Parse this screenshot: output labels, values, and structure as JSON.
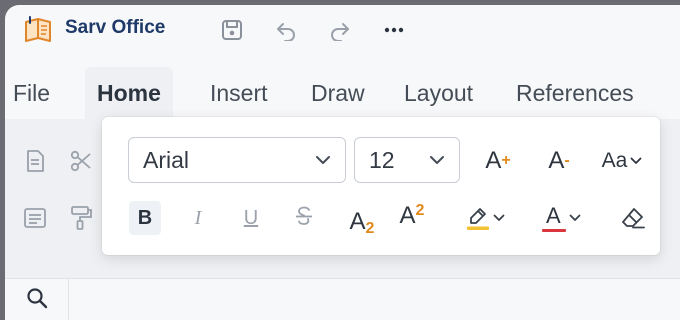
{
  "app": {
    "title": "Sarv Office"
  },
  "toolbar": {
    "save_icon": "save-icon",
    "undo_icon": "undo-icon",
    "redo_icon": "redo-icon",
    "more_icon": "more-icon"
  },
  "menu": {
    "tabs": [
      {
        "label": "File"
      },
      {
        "label": "Home"
      },
      {
        "label": "Insert"
      },
      {
        "label": "Draw"
      },
      {
        "label": "Layout"
      },
      {
        "label": "References"
      }
    ],
    "active": "Home"
  },
  "font_popup": {
    "font_name": "Arial",
    "font_size": "12",
    "grow_label": "A",
    "grow_mod": "+",
    "shrink_label": "A",
    "shrink_mod": "-",
    "case_label": "Aa",
    "bold_label": "B",
    "italic_label": "I",
    "underline_label": "U",
    "subscript_base": "A",
    "subscript_mod": "2",
    "superscript_base": "A",
    "superscript_mod": "2",
    "font_color_label": "A",
    "highlight_color": "#f2c232",
    "font_color": "#d9363e",
    "accent_orange": "#e08a1e"
  }
}
